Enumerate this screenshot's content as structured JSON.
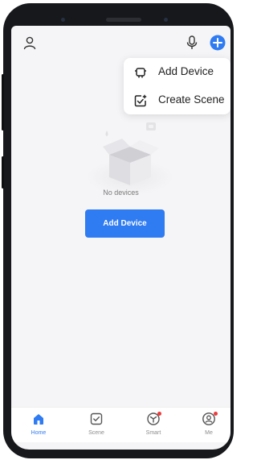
{
  "header": {
    "profile_icon": "person-outline-icon",
    "mic_icon": "microphone-icon",
    "add_icon": "plus-circle-icon"
  },
  "menu": {
    "items": [
      {
        "label": "Add Device",
        "icon": "device-add-icon"
      },
      {
        "label": "Create Scene",
        "icon": "scene-create-icon"
      }
    ]
  },
  "empty_state": {
    "illustration": "empty-box-icon",
    "message": "No devices",
    "button_label": "Add Device"
  },
  "tabbar": {
    "tabs": [
      {
        "label": "Home",
        "icon": "home-icon",
        "active": true,
        "badge": false
      },
      {
        "label": "Scene",
        "icon": "scene-check-icon",
        "active": false,
        "badge": false
      },
      {
        "label": "Smart",
        "icon": "smart-cube-icon",
        "active": false,
        "badge": true
      },
      {
        "label": "Me",
        "icon": "user-circle-icon",
        "active": false,
        "badge": true
      }
    ]
  },
  "colors": {
    "accent": "#2f7bf2",
    "badge": "#ee3b3b",
    "background": "#f5f5f7"
  }
}
